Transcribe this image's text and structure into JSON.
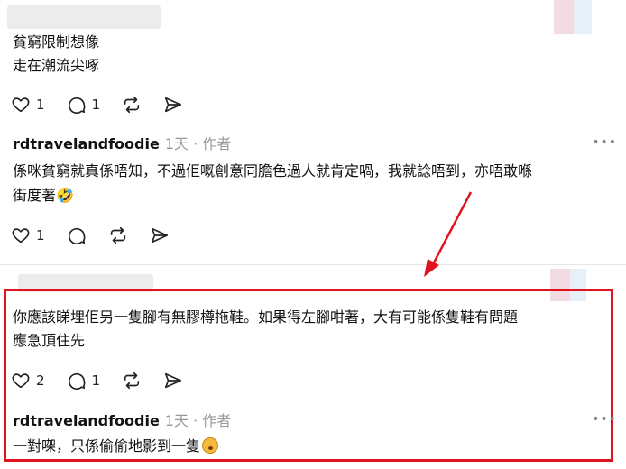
{
  "comments": [
    {
      "lines": [
        "貧窮限制想像",
        "走在潮流尖啄"
      ],
      "likes": "1",
      "replies": "1"
    },
    {
      "username": "rdtravelandfoodie",
      "meta": "1天 · 作者",
      "lines": [
        "係咪貧窮就真係唔知，不過佢嘅創意同膽色過人就肯定喎，我就諗唔到，亦唔敢喺",
        "街度著🤣"
      ],
      "likes": "1",
      "replies": ""
    },
    {
      "lines": [
        "你應該睇埋佢另一隻腳有無膠樽拖鞋。如果得左腳咁著，大有可能係隻鞋有問題",
        "應急頂住先"
      ],
      "likes": "2",
      "replies": "1"
    },
    {
      "username": "rdtravelandfoodie",
      "meta": "1天 · 作者",
      "lines": [
        "一對㗎，只係偷偷地影到一隻"
      ]
    }
  ],
  "more_label": "•••",
  "colors": {
    "highlight": "#e0141e",
    "arrow": "#e0141e"
  },
  "icons": [
    "heart-icon",
    "comment-icon",
    "repost-icon",
    "share-icon",
    "more-icon",
    "emoji-icon"
  ]
}
